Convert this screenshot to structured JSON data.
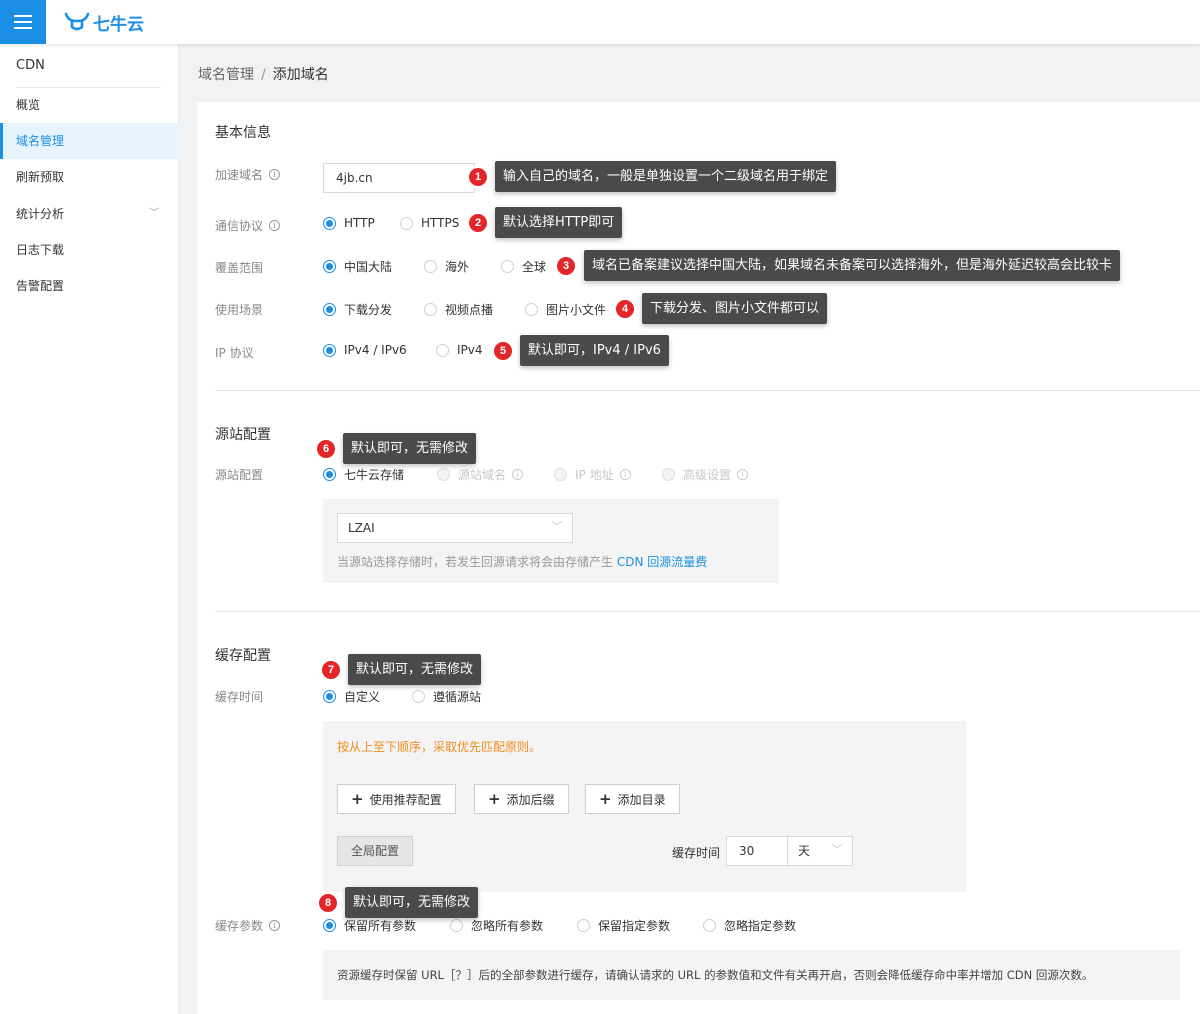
{
  "brand": {
    "logo_text": "七牛云"
  },
  "sidebar": {
    "title": "CDN",
    "items": [
      {
        "label": "概览"
      },
      {
        "label": "域名管理"
      },
      {
        "label": "刷新预取"
      },
      {
        "label": "统计分析"
      },
      {
        "label": "日志下载"
      },
      {
        "label": "告警配置"
      }
    ]
  },
  "breadcrumb": {
    "parent": "域名管理",
    "separator": "/",
    "current": "添加域名"
  },
  "basic": {
    "title": "基本信息",
    "domain": {
      "label": "加速域名",
      "value": "4jb.cn"
    },
    "protocol": {
      "label": "通信协议",
      "options": [
        "HTTP",
        "HTTPS"
      ]
    },
    "coverage": {
      "label": "覆盖范围",
      "options": [
        "中国大陆",
        "海外",
        "全球"
      ]
    },
    "scenario": {
      "label": "使用场景",
      "options": [
        "下载分发",
        "视频点播",
        "图片小文件"
      ]
    },
    "ip": {
      "label": "IP 协议",
      "options": [
        "IPv4 / IPv6",
        "IPv4"
      ]
    }
  },
  "origin": {
    "title": "源站配置",
    "label": "源站配置",
    "options": [
      "七牛云存储",
      "源站域名",
      "IP 地址",
      "高级设置"
    ],
    "bucket": "LZAI",
    "hint_prefix": "当源站选择存储时，若发生回源请求将会由存储产生",
    "hint_link": "CDN 回源流量费"
  },
  "cache": {
    "title": "缓存配置",
    "time_label": "缓存时间",
    "time_options": [
      "自定义",
      "遵循源站"
    ],
    "rule_hint": "按从上至下顺序，采取优先匹配原则。",
    "buttons": [
      "使用推荐配置",
      "添加后缀",
      "添加目录"
    ],
    "global_button": "全局配置",
    "duration_label": "缓存时间",
    "duration_value": "30",
    "duration_unit": "天",
    "param_label": "缓存参数",
    "param_options": [
      "保留所有参数",
      "忽略所有参数",
      "保留指定参数",
      "忽略指定参数"
    ],
    "param_hint": "资源缓存时保留 URL［？］后的全部参数进行缓存，请确认请求的 URL 的参数值和文件有关再开启，否则会降低缓存命中率并增加 CDN 回源次数。"
  },
  "annotations": [
    {
      "num": "1",
      "text": "输入自己的域名，一般是单独设置一个二级域名用于绑定"
    },
    {
      "num": "2",
      "text": "默认选择HTTP即可"
    },
    {
      "num": "3",
      "text": "域名已备案建议选择中国大陆，如果域名未备案可以选择海外，但是海外延迟较高会比较卡"
    },
    {
      "num": "4",
      "text": "下载分发、图片小文件都可以"
    },
    {
      "num": "5",
      "text": "默认即可，IPv4 / IPv6"
    },
    {
      "num": "6",
      "text": "默认即可，无需修改"
    },
    {
      "num": "7",
      "text": "默认即可，无需修改"
    },
    {
      "num": "8",
      "text": "默认即可，无需修改"
    }
  ],
  "colors": {
    "accent": "#1b8fe5",
    "badge": "#e3262a",
    "tooltip_bg": "#4a4a4a",
    "warning": "#f08c1c"
  }
}
